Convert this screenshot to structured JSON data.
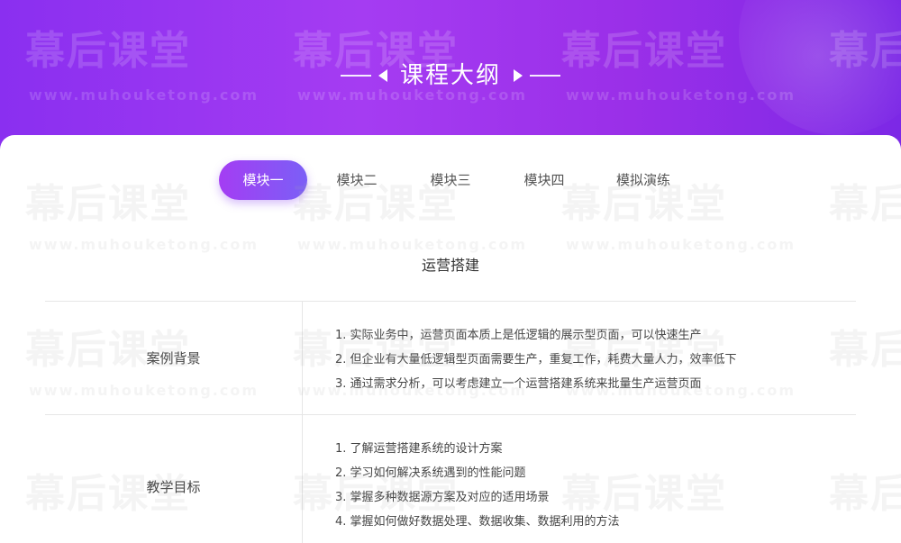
{
  "hero": {
    "title": "课程大纲"
  },
  "tabs": [
    {
      "label": "模块一",
      "active": true
    },
    {
      "label": "模块二",
      "active": false
    },
    {
      "label": "模块三",
      "active": false
    },
    {
      "label": "模块四",
      "active": false
    },
    {
      "label": "模拟演练",
      "active": false
    }
  ],
  "module": {
    "title": "运营搭建",
    "rows": [
      {
        "label": "案例背景",
        "items": [
          "1. 实际业务中，运营页面本质上是低逻辑的展示型页面，可以快速生产",
          "2. 但企业有大量低逻辑型页面需要生产，重复工作，耗费大量人力，效率低下",
          "3. 通过需求分析，可以考虑建立一个运营搭建系统来批量生产运营页面"
        ]
      },
      {
        "label": "教学目标",
        "items": [
          "1. 了解运营搭建系统的设计方案",
          "2. 学习如何解决系统遇到的性能问题",
          "3. 掌握多种数据源方案及对应的适用场景",
          "4. 掌握如何做好数据处理、数据收集、数据利用的方法"
        ]
      }
    ]
  },
  "watermark": {
    "brand": "幕后课堂",
    "url": "www.muhouketong.com"
  },
  "colors": {
    "hero_start": "#8a2ff0",
    "hero_end": "#7c28e6",
    "tab_active_start": "#a43df3",
    "tab_active_end": "#7b5ff6",
    "text": "#444444"
  }
}
